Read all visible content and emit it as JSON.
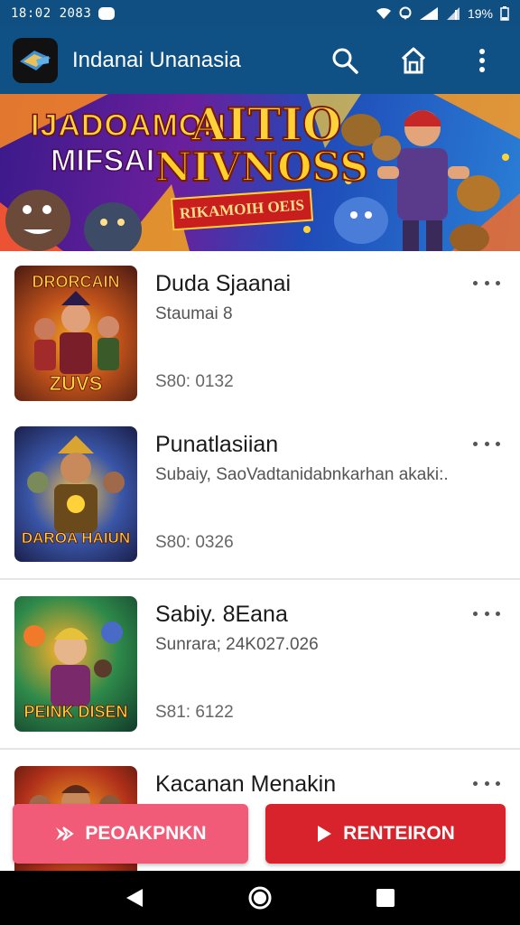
{
  "status_bar": {
    "time": "18:02 2083",
    "battery": "19%"
  },
  "app_bar": {
    "title": "Indanai Unanasia",
    "icons": [
      "search-icon",
      "home-icon",
      "more-vert-icon"
    ],
    "brand_color": "#0f5184"
  },
  "banner": {
    "line1": "IJADOAMON",
    "line2": "MIFSAI",
    "title_line1": "AITIO",
    "title_line2": "NIVNOSS",
    "ribbon": "RIKAMOIH OEIS"
  },
  "items": [
    {
      "thumb_label_top": "DRORCAIN",
      "thumb_label_bottom": "ZUVS",
      "title": "Duda Sjaanai",
      "subtitle": "Staumai 8",
      "meta": "S80: 0132"
    },
    {
      "thumb_label_top": "",
      "thumb_label_bottom": "DAROA HAIUN",
      "title": "Punatlasiian",
      "subtitle": "Subaiy, SaoVadtanidabnkarhan akaki:.",
      "meta": "S80: 0326"
    },
    {
      "thumb_label_top": "",
      "thumb_label_bottom": "PEINK DISEN",
      "title": "Sabiy. 8Eana",
      "subtitle": "Sunrara; 24K027.026",
      "meta": "S81: 6122"
    },
    {
      "thumb_label_top": "",
      "thumb_label_bottom": "",
      "title": "Kacanan Menakin",
      "subtitle": "",
      "meta": ""
    }
  ],
  "buttons": {
    "left_label": "PEOAKPNKN",
    "right_label": "RENTEIRON",
    "left_color": "#f25b78",
    "right_color": "#d8222c"
  },
  "nav": {
    "icons": [
      "back-icon",
      "home-circle-icon",
      "recents-icon"
    ]
  }
}
